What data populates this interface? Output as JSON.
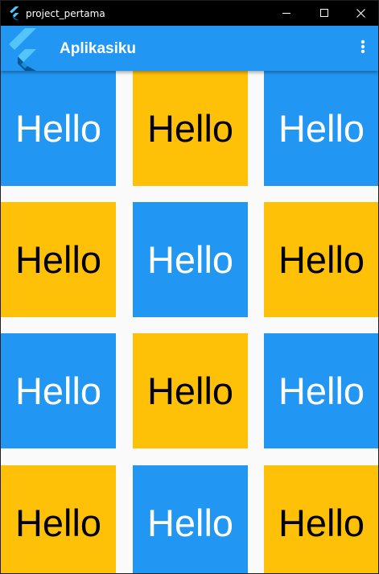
{
  "window": {
    "title": "project_pertama"
  },
  "appbar": {
    "title": "Aplikasiku"
  },
  "colors": {
    "primary": "#2196f3",
    "amber": "#ffc107",
    "background": "#fafafa"
  },
  "icons": {
    "app": "flutter-logo-icon",
    "minimize": "minimize-icon",
    "maximize": "maximize-icon",
    "close": "close-icon",
    "more": "more-vert-icon"
  },
  "grid": {
    "columns": 3,
    "tiles": [
      {
        "label": "Hello",
        "color": "blue"
      },
      {
        "label": "Hello",
        "color": "amber"
      },
      {
        "label": "Hello",
        "color": "blue"
      },
      {
        "label": "Hello",
        "color": "amber"
      },
      {
        "label": "Hello",
        "color": "blue"
      },
      {
        "label": "Hello",
        "color": "amber"
      },
      {
        "label": "Hello",
        "color": "blue"
      },
      {
        "label": "Hello",
        "color": "amber"
      },
      {
        "label": "Hello",
        "color": "blue"
      },
      {
        "label": "Hello",
        "color": "amber"
      },
      {
        "label": "Hello",
        "color": "blue"
      },
      {
        "label": "Hello",
        "color": "amber"
      }
    ]
  }
}
